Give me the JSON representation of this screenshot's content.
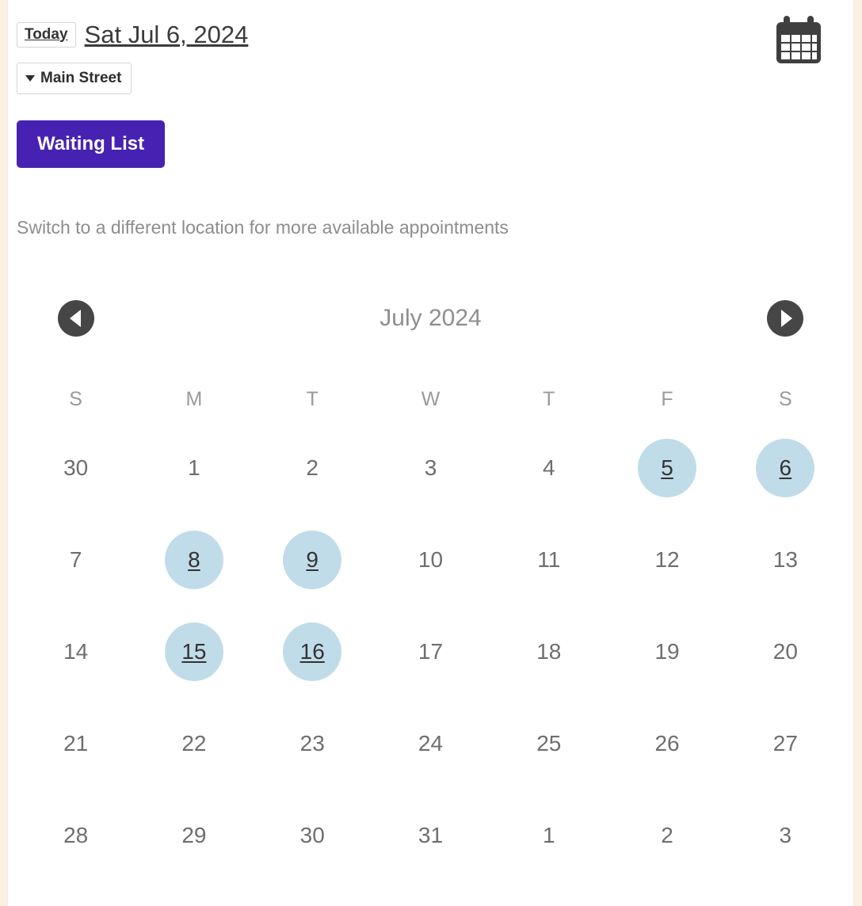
{
  "header": {
    "today_label": "Today",
    "date_title": "Sat Jul 6, 2024",
    "location_label": "Main Street",
    "calendar_icon": "calendar-icon"
  },
  "actions": {
    "waiting_list_label": "Waiting List",
    "switch_note": "Switch to a different location for more available appointments"
  },
  "calendar": {
    "prev_icon": "chevron-left-icon",
    "next_icon": "chevron-right-icon",
    "month_label": "July 2024",
    "weekdays": [
      "S",
      "M",
      "T",
      "W",
      "T",
      "F",
      "S"
    ],
    "weeks": [
      [
        {
          "day": "30",
          "available": false
        },
        {
          "day": "1",
          "available": false
        },
        {
          "day": "2",
          "available": false
        },
        {
          "day": "3",
          "available": false
        },
        {
          "day": "4",
          "available": false
        },
        {
          "day": "5",
          "available": true
        },
        {
          "day": "6",
          "available": true
        }
      ],
      [
        {
          "day": "7",
          "available": false
        },
        {
          "day": "8",
          "available": true
        },
        {
          "day": "9",
          "available": true
        },
        {
          "day": "10",
          "available": false
        },
        {
          "day": "11",
          "available": false
        },
        {
          "day": "12",
          "available": false
        },
        {
          "day": "13",
          "available": false
        }
      ],
      [
        {
          "day": "14",
          "available": false
        },
        {
          "day": "15",
          "available": true
        },
        {
          "day": "16",
          "available": true
        },
        {
          "day": "17",
          "available": false
        },
        {
          "day": "18",
          "available": false
        },
        {
          "day": "19",
          "available": false
        },
        {
          "day": "20",
          "available": false
        }
      ],
      [
        {
          "day": "21",
          "available": false
        },
        {
          "day": "22",
          "available": false
        },
        {
          "day": "23",
          "available": false
        },
        {
          "day": "24",
          "available": false
        },
        {
          "day": "25",
          "available": false
        },
        {
          "day": "26",
          "available": false
        },
        {
          "day": "27",
          "available": false
        }
      ],
      [
        {
          "day": "28",
          "available": false
        },
        {
          "day": "29",
          "available": false
        },
        {
          "day": "30",
          "available": false
        },
        {
          "day": "31",
          "available": false
        },
        {
          "day": "1",
          "available": false
        },
        {
          "day": "2",
          "available": false
        },
        {
          "day": "3",
          "available": false
        }
      ]
    ]
  },
  "colors": {
    "brand_purple": "#4722b2",
    "available_day": "#c1dce9",
    "nav_circle": "#464646",
    "page_edge": "#fbf1e0"
  }
}
